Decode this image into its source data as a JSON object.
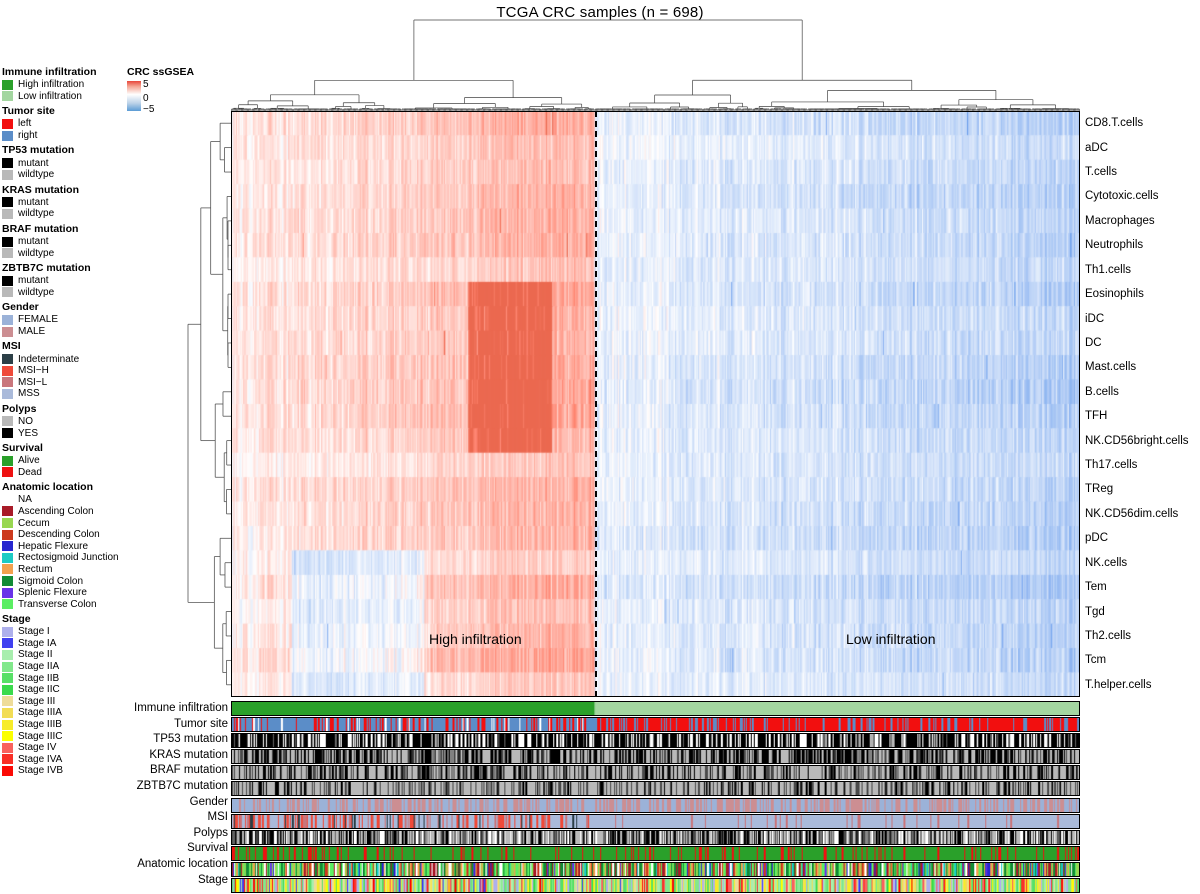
{
  "title": "TCGA CRC samples (n = 698)",
  "scale_legend": {
    "title": "CRC ssGSEA",
    "ticks": [
      "5",
      "0",
      "−5"
    ],
    "high_color": "#e8463a",
    "mid_color": "#ffffff",
    "low_color": "#5b9bd5"
  },
  "cluster_labels": {
    "high": "High infiltration",
    "low": "Low infiltration",
    "split_x_fraction": 0.429
  },
  "legend_groups": [
    {
      "title": "Immune infiltration",
      "items": [
        {
          "label": "High infiltration",
          "color": "#2aa02a"
        },
        {
          "label": "Low infiltration",
          "color": "#a3d6a0"
        }
      ]
    },
    {
      "title": "Tumor site",
      "items": [
        {
          "label": "left",
          "color": "#f20f0f"
        },
        {
          "label": "right",
          "color": "#5b8dc8"
        }
      ]
    },
    {
      "title": "TP53 mutation",
      "items": [
        {
          "label": "mutant",
          "color": "#000000"
        },
        {
          "label": "wildtype",
          "color": "#b9b9b9"
        }
      ]
    },
    {
      "title": "KRAS mutation",
      "items": [
        {
          "label": "mutant",
          "color": "#000000"
        },
        {
          "label": "wildtype",
          "color": "#b9b9b9"
        }
      ]
    },
    {
      "title": "BRAF mutation",
      "items": [
        {
          "label": "mutant",
          "color": "#000000"
        },
        {
          "label": "wildtype",
          "color": "#b9b9b9"
        }
      ]
    },
    {
      "title": "ZBTB7C mutation",
      "items": [
        {
          "label": "mutant",
          "color": "#000000"
        },
        {
          "label": "wildtype",
          "color": "#b9b9b9"
        }
      ]
    },
    {
      "title": "Gender",
      "items": [
        {
          "label": "FEMALE",
          "color": "#9bb2d8"
        },
        {
          "label": "MALE",
          "color": "#cc8e92"
        }
      ]
    },
    {
      "title": "MSI",
      "items": [
        {
          "label": "Indeterminate",
          "color": "#2c3f47"
        },
        {
          "label": "MSI−H",
          "color": "#ef4a3a"
        },
        {
          "label": "MSI−L",
          "color": "#c9767c"
        },
        {
          "label": "MSS",
          "color": "#aabada"
        }
      ]
    },
    {
      "title": "Polyps",
      "items": [
        {
          "label": "NO",
          "color": "#b9b9b9"
        },
        {
          "label": "YES",
          "color": "#000000"
        }
      ]
    },
    {
      "title": "Survival",
      "items": [
        {
          "label": "Alive",
          "color": "#2aa02a"
        },
        {
          "label": "Dead",
          "color": "#ee1111"
        }
      ]
    },
    {
      "title": "Anatomic location",
      "items": [
        {
          "label": "NA",
          "color": "#ffffff"
        },
        {
          "label": "Ascending Colon",
          "color": "#a81b28"
        },
        {
          "label": "Cecum",
          "color": "#98d751"
        },
        {
          "label": "Descending Colon",
          "color": "#cc3a1e"
        },
        {
          "label": "Hepatic Flexure",
          "color": "#2727cf"
        },
        {
          "label": "Rectosigmoid Junction",
          "color": "#1ccbc4"
        },
        {
          "label": "Rectum",
          "color": "#f3a14e"
        },
        {
          "label": "Sigmoid Colon",
          "color": "#128b36"
        },
        {
          "label": "Splenic Flexure",
          "color": "#6932e8"
        },
        {
          "label": "Transverse Colon",
          "color": "#5bee63"
        }
      ]
    },
    {
      "title": "Stage",
      "items": [
        {
          "label": "Stage I",
          "color": "#aeb0ec"
        },
        {
          "label": "Stage IA",
          "color": "#4040f0"
        },
        {
          "label": "Stage II",
          "color": "#a8eeae"
        },
        {
          "label": "Stage IIA",
          "color": "#82e88c"
        },
        {
          "label": "Stage IIB",
          "color": "#58e067"
        },
        {
          "label": "Stage IIC",
          "color": "#3ada4c"
        },
        {
          "label": "Stage III",
          "color": "#eedc9a"
        },
        {
          "label": "Stage IIIA",
          "color": "#f2dd55"
        },
        {
          "label": "Stage IIIB",
          "color": "#f7ec2a"
        },
        {
          "label": "Stage IIIC",
          "color": "#fbff00"
        },
        {
          "label": "Stage IV",
          "color": "#f9625e"
        },
        {
          "label": "Stage IVA",
          "color": "#f92f26"
        },
        {
          "label": "Stage IVB",
          "color": "#fb0a05"
        }
      ]
    }
  ],
  "row_labels": [
    "CD8.T.cells",
    "aDC",
    "T.cells",
    "Cytotoxic.cells",
    "Macrophages",
    "Neutrophils",
    "Th1.cells",
    "Eosinophils",
    "iDC",
    "DC",
    "Mast.cells",
    "B.cells",
    "TFH",
    "NK.CD56bright.cells",
    "Th17.cells",
    "TReg",
    "NK.CD56dim.cells",
    "pDC",
    "NK.cells",
    "Tem",
    "Tgd",
    "Th2.cells",
    "Tcm",
    "T.helper.cells"
  ],
  "annotation_rows": [
    {
      "name": "Immune infiltration",
      "palette": [
        "#2aa02a",
        "#a3d6a0"
      ],
      "mode": "split"
    },
    {
      "name": "Tumor site",
      "palette": [
        "#f20f0f",
        "#5b8dc8",
        "#ffffff"
      ],
      "weights": [
        0.45,
        0.5,
        0.05
      ]
    },
    {
      "name": "TP53 mutation",
      "palette": [
        "#000000",
        "#ffffff"
      ],
      "weights": [
        0.58,
        0.42
      ]
    },
    {
      "name": "KRAS mutation",
      "palette": [
        "#000000",
        "#b9b9b9"
      ],
      "weights": [
        0.42,
        0.58
      ]
    },
    {
      "name": "BRAF mutation",
      "palette": [
        "#000000",
        "#b9b9b9"
      ],
      "weights": [
        0.25,
        0.75
      ]
    },
    {
      "name": "ZBTB7C mutation",
      "palette": [
        "#000000",
        "#b9b9b9"
      ],
      "weights": [
        0.14,
        0.86
      ]
    },
    {
      "name": "Gender",
      "palette": [
        "#9bb2d8",
        "#cc8e92"
      ],
      "weights": [
        0.47,
        0.53
      ]
    },
    {
      "name": "MSI",
      "palette": [
        "#2c3f47",
        "#ef4a3a",
        "#c9767c",
        "#aabada"
      ],
      "weights": [
        0.04,
        0.17,
        0.08,
        0.71
      ]
    },
    {
      "name": "Polyps",
      "palette": [
        "#000000",
        "#b9b9b9",
        "#ffffff"
      ],
      "weights": [
        0.3,
        0.4,
        0.3
      ]
    },
    {
      "name": "Survival",
      "palette": [
        "#2aa02a",
        "#ee1111"
      ],
      "weights": [
        0.82,
        0.18
      ]
    },
    {
      "name": "Anatomic location",
      "palette": [
        "#ffffff",
        "#a81b28",
        "#98d751",
        "#cc3a1e",
        "#2727cf",
        "#1ccbc4",
        "#f3a14e",
        "#128b36",
        "#6932e8",
        "#5bee63"
      ],
      "weights": [
        0.1,
        0.13,
        0.12,
        0.06,
        0.04,
        0.05,
        0.1,
        0.2,
        0.03,
        0.17
      ]
    },
    {
      "name": "Stage",
      "palette": [
        "#aeb0ec",
        "#4040f0",
        "#a8eeae",
        "#82e88c",
        "#58e067",
        "#3ada4c",
        "#eedc9a",
        "#f2dd55",
        "#f7ec2a",
        "#fbff00",
        "#f9625e",
        "#f92f26",
        "#fb0a05"
      ],
      "weights": [
        0.12,
        0.03,
        0.12,
        0.14,
        0.09,
        0.02,
        0.09,
        0.1,
        0.1,
        0.04,
        0.08,
        0.04,
        0.03
      ]
    }
  ],
  "chart_data": {
    "type": "heatmap",
    "title": "TCGA CRC samples (n = 698)",
    "n_samples": 698,
    "n_rows": 24,
    "value_label": "CRC ssGSEA",
    "zlim": [
      -5,
      5
    ],
    "colormap": "red-white-blue (RdBu reversed)",
    "row_order": [
      "CD8.T.cells",
      "aDC",
      "T.cells",
      "Cytotoxic.cells",
      "Macrophages",
      "Neutrophils",
      "Th1.cells",
      "Eosinophils",
      "iDC",
      "DC",
      "Mast.cells",
      "B.cells",
      "TFH",
      "NK.CD56bright.cells",
      "Th17.cells",
      "TReg",
      "NK.CD56dim.cells",
      "pDC",
      "NK.cells",
      "Tem",
      "Tgd",
      "Th2.cells",
      "Tcm",
      "T.helper.cells"
    ],
    "column_clusters": [
      {
        "label": "High infiltration",
        "fraction": 0.429,
        "mean_z": 1.2
      },
      {
        "label": "Low infiltration",
        "fraction": 0.571,
        "mean_z": -0.9
      }
    ],
    "row_dendrogram": true,
    "column_dendrogram": true,
    "annotation_tracks": [
      "Immune infiltration",
      "Tumor site",
      "TP53 mutation",
      "KRAS mutation",
      "BRAF mutation",
      "ZBTB7C mutation",
      "Gender",
      "MSI",
      "Polyps",
      "Survival",
      "Anatomic location",
      "Stage"
    ]
  }
}
